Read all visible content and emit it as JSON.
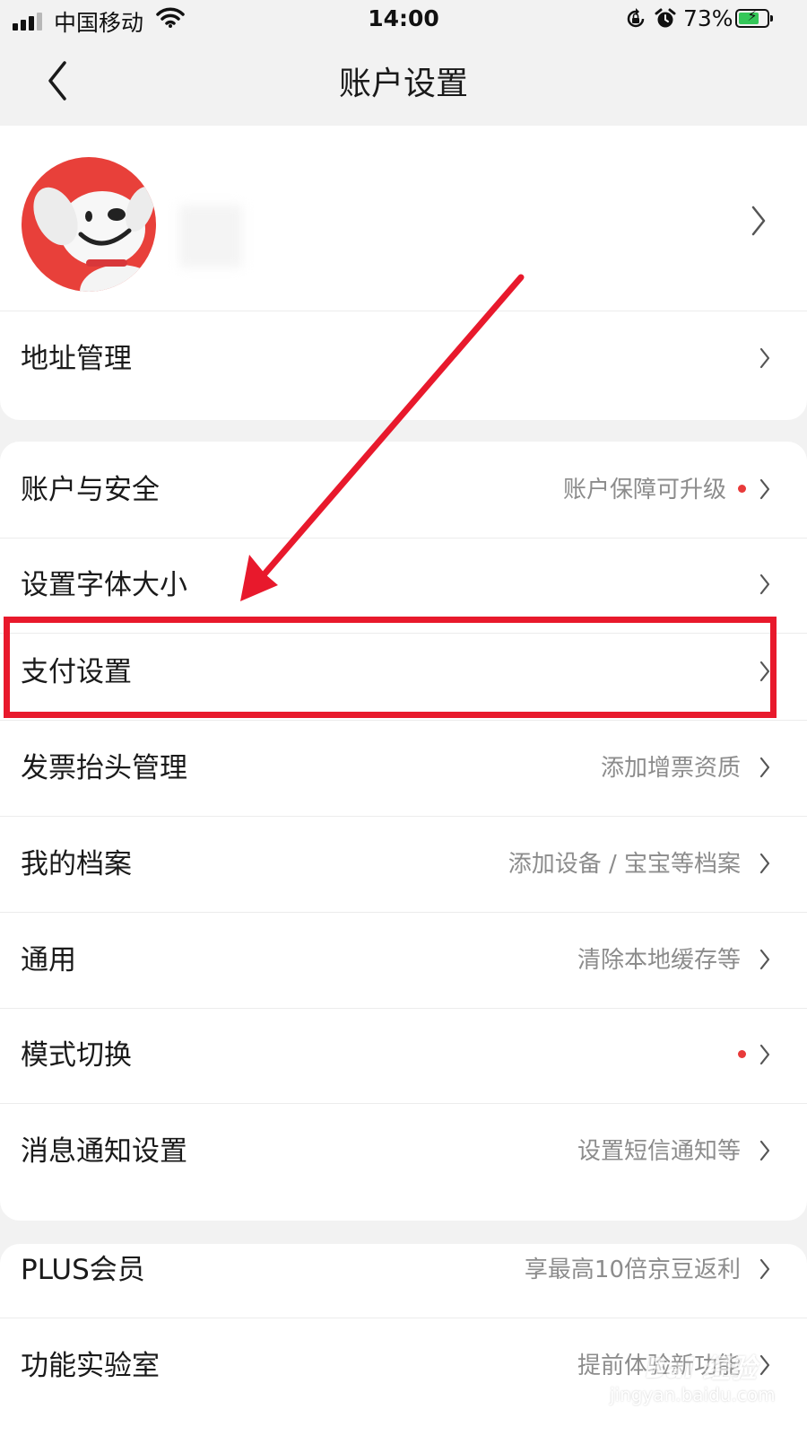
{
  "status_bar": {
    "carrier": "中国移动",
    "time": "14:00",
    "battery_percent": "73%",
    "battery_level": 0.73,
    "signal_bars": 3,
    "signal_bars_total": 4
  },
  "header": {
    "title": "账户设置",
    "back_icon": "chevron-left-icon"
  },
  "profile": {
    "avatar": "dog-mascot-avatar"
  },
  "section1": {
    "items": [
      {
        "label": "地址管理",
        "subtitle": ""
      }
    ]
  },
  "section2": {
    "items": [
      {
        "label": "账户与安全",
        "subtitle": "账户保障可升级",
        "dot": true
      },
      {
        "label": "设置字体大小",
        "subtitle": ""
      },
      {
        "label": "支付设置",
        "subtitle": ""
      },
      {
        "label": "发票抬头管理",
        "subtitle": "添加增票资质"
      },
      {
        "label": "我的档案",
        "subtitle": "添加设备 / 宝宝等档案"
      },
      {
        "label": "通用",
        "subtitle": "清除本地缓存等"
      },
      {
        "label": "模式切换",
        "subtitle": "",
        "dot": true
      },
      {
        "label": "消息通知设置",
        "subtitle": "设置短信通知等"
      }
    ]
  },
  "section3": {
    "items": [
      {
        "label": "PLUS会员",
        "subtitle": "享最高10倍京豆返利"
      },
      {
        "label": "功能实验室",
        "subtitle": "提前体验新功能"
      }
    ]
  },
  "watermark": {
    "brand": "Bai 经验",
    "domain": "jingyan.baidu.com"
  },
  "colors": {
    "accent_red": "#e8192c",
    "notification_dot": "#e83a3a",
    "battery_green": "#34c759",
    "subtitle_gray": "#8c8c8c",
    "page_background": "#f2f2f2"
  }
}
